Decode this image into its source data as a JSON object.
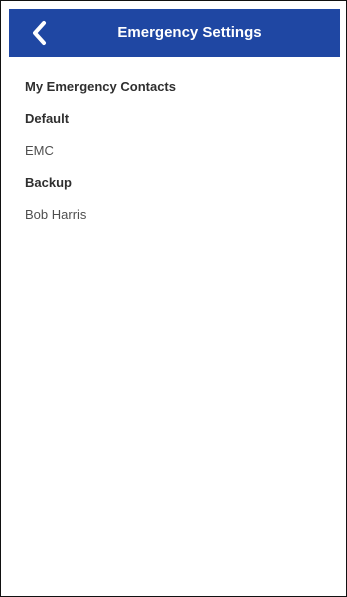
{
  "header": {
    "title": "Emergency Settings",
    "back_icon": "chevron-left-icon",
    "background_color": "#1f47a3",
    "text_color": "#ffffff"
  },
  "emergency": {
    "section_title": "My Emergency Contacts",
    "default_label": "Default",
    "default_value": "EMC",
    "backup_label": "Backup",
    "backup_value": "Bob Harris"
  }
}
